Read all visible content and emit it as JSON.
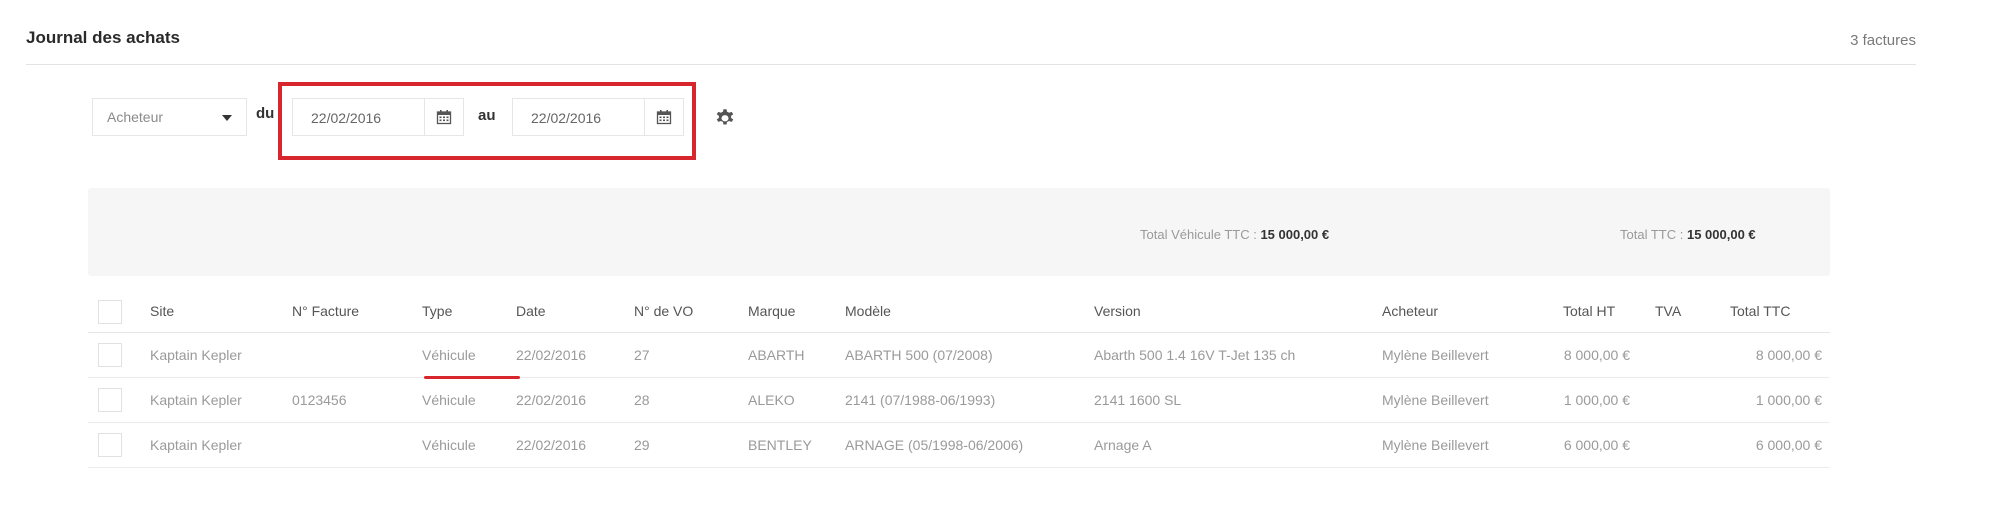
{
  "header": {
    "title": "Journal des achats",
    "count": "3 factures"
  },
  "filters": {
    "buyer_select": "Acheteur",
    "from_label": "du",
    "from_date": "22/02/2016",
    "to_label": "au",
    "to_date": "22/02/2016"
  },
  "summary": {
    "vehicule_label": "Total Véhicule TTC :",
    "vehicule_value": "15 000,00 €",
    "ttc_label": "Total TTC :",
    "ttc_value": "15 000,00 €"
  },
  "table": {
    "columns": [
      "Site",
      "N° Facture",
      "Type",
      "Date",
      "N° de VO",
      "Marque",
      "Modèle",
      "Version",
      "Acheteur",
      "Total HT",
      "TVA",
      "Total TTC"
    ],
    "rows": [
      {
        "site": "Kaptain Kepler",
        "facture": "",
        "type": "Véhicule",
        "date": "22/02/2016",
        "vo": "27",
        "marque": "ABARTH",
        "modele": "ABARTH 500 (07/2008)",
        "version": "Abarth 500 1.4 16V T-Jet 135 ch",
        "acheteur": "Mylène Beillevert",
        "ht": "8 000,00 €",
        "tva": "",
        "ttc": "8 000,00 €"
      },
      {
        "site": "Kaptain Kepler",
        "facture": "0123456",
        "type": "Véhicule",
        "date": "22/02/2016",
        "vo": "28",
        "marque": "ALEKO",
        "modele": "2141 (07/1988-06/1993)",
        "version": "2141 1600 SL",
        "acheteur": "Mylène Beillevert",
        "ht": "1 000,00 €",
        "tva": "",
        "ttc": "1 000,00 €"
      },
      {
        "site": "Kaptain Kepler",
        "facture": "",
        "type": "Véhicule",
        "date": "22/02/2016",
        "vo": "29",
        "marque": "BENTLEY",
        "modele": "ARNAGE (05/1998-06/2006)",
        "version": "Arnage A",
        "acheteur": "Mylène Beillevert",
        "ht": "6 000,00 €",
        "tva": "",
        "ttc": "6 000,00 €"
      }
    ]
  },
  "icons": {
    "calendar": "calendar-icon",
    "settings": "gear-icon",
    "dropdown": "chevron-down-icon"
  },
  "colors": {
    "highlight": "#d8262e",
    "summary_bg": "#f6f6f6"
  }
}
